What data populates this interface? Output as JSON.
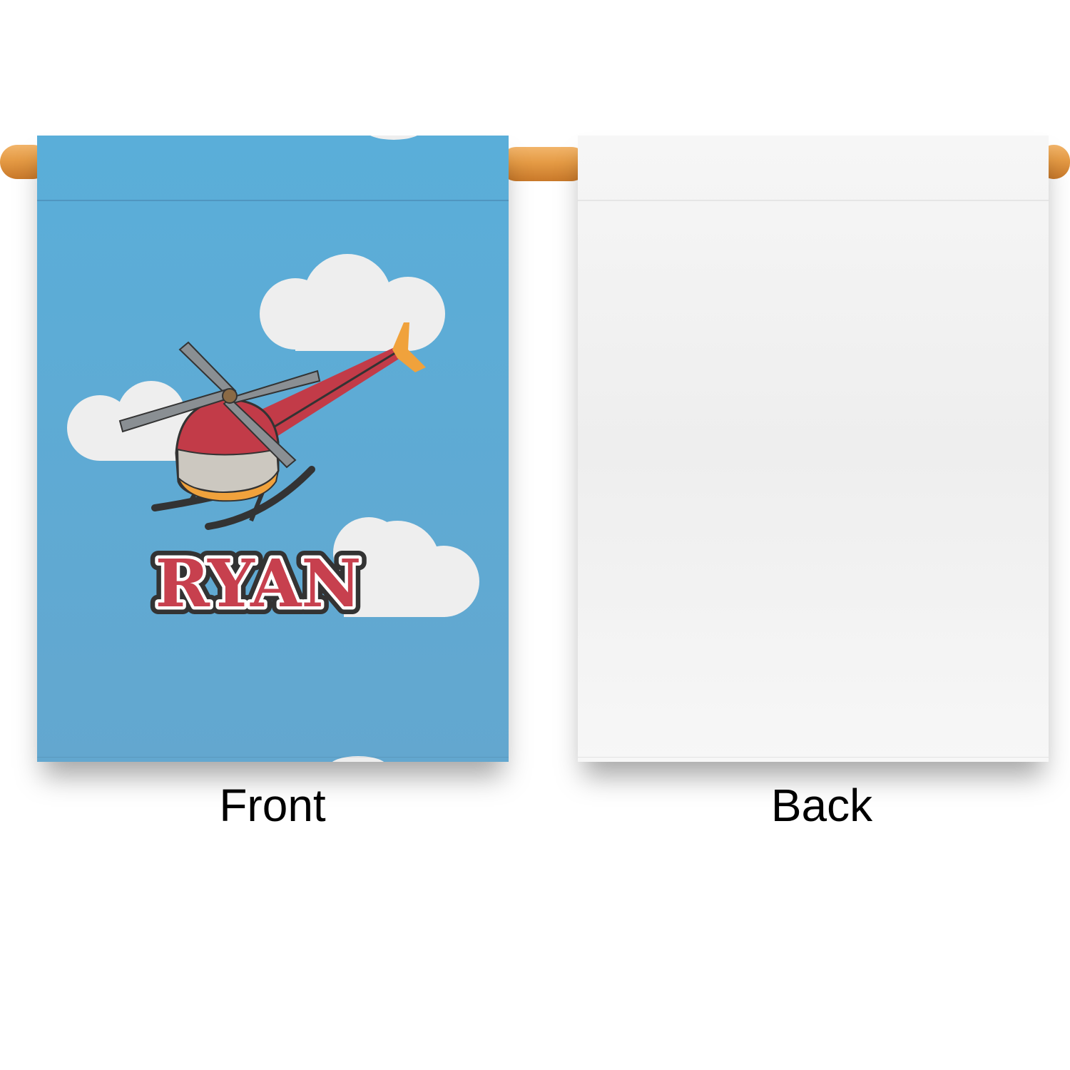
{
  "personalization": {
    "name": "RYAN"
  },
  "labels": {
    "front": "Front",
    "back": "Back"
  },
  "colors": {
    "sky": "#5fa9d2",
    "cloud": "#eeeeee",
    "helicopter_body": "#c23b48",
    "helicopter_tail": "#f0a23c",
    "rotor": "#8a8f93",
    "name_fill": "#c7404e",
    "name_outline": "#333333",
    "rod": "#e59b45",
    "flag_back": "#f4f4f4"
  },
  "icons": {
    "front_art": "helicopter-icon",
    "clouds": "cloud-icon"
  }
}
